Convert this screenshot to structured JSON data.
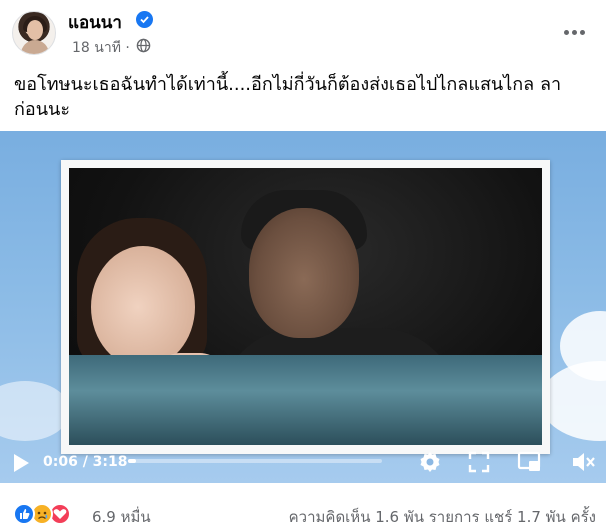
{
  "post": {
    "author": "แอนนา",
    "timestamp": "18 นาที ·",
    "text": "ขอโทษนะเธอฉันทำได้เท่านี้....อีกไม่กี่วันก็ต้องส่งเธอไปไกลแสนไกล ลาก่อนนะ"
  },
  "video": {
    "time": "0:06 / 3:18",
    "progress": 0.03
  },
  "footer": {
    "reaction_count": "6.9 หมื่น",
    "comments": "ความคิดเห็น 1.6 พัน รายการ",
    "shares": "แชร์ 1.7 พัน ครั้ง"
  },
  "colors": {
    "accent": "#1877f2",
    "muted_text": "#65676b"
  },
  "icons": [
    "verified-badge-icon",
    "globe-icon",
    "more-options-icon",
    "play-icon",
    "settings-icon",
    "fullscreen-icon",
    "pip-icon",
    "volume-muted-icon",
    "like-reaction-icon",
    "sad-reaction-icon",
    "love-reaction-icon"
  ]
}
